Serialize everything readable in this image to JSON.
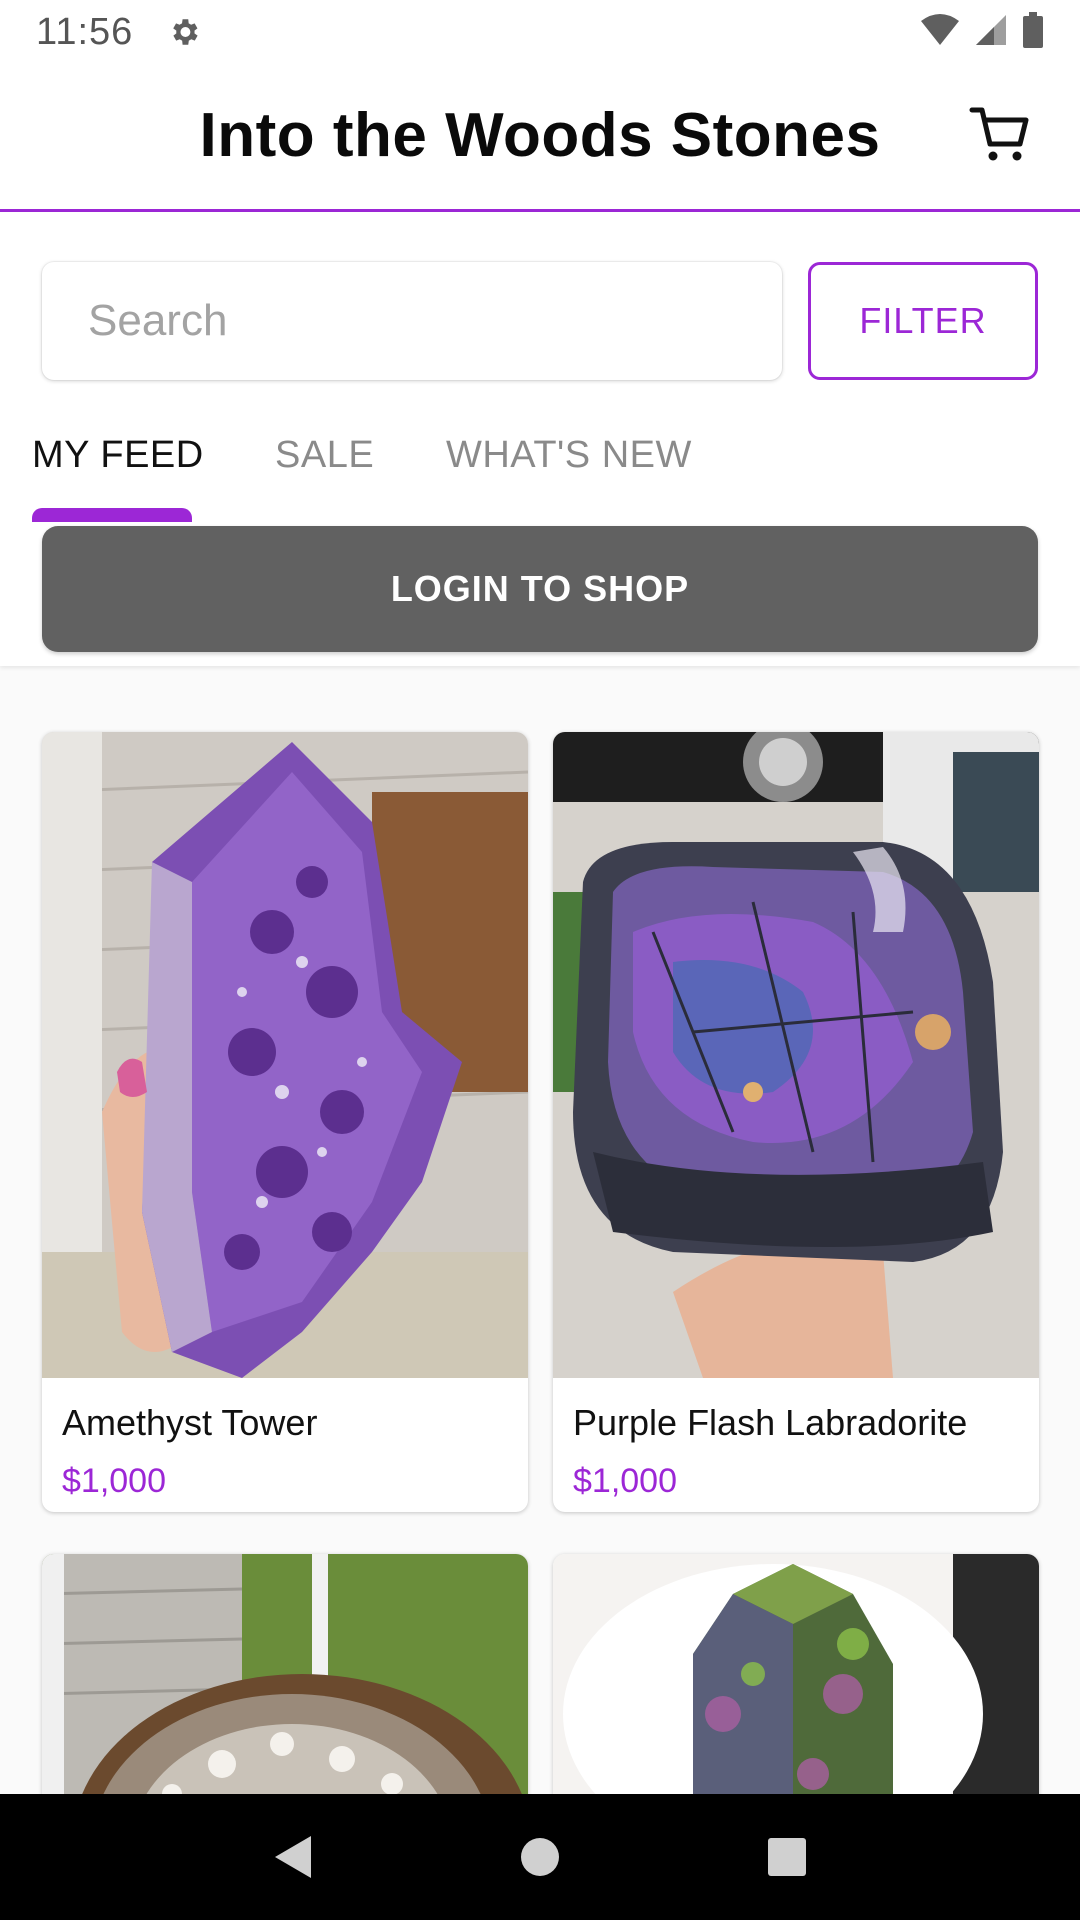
{
  "status_bar": {
    "time": "11:56",
    "icons": [
      "gear-icon",
      "wifi-icon",
      "signal-icon",
      "battery-icon"
    ]
  },
  "header": {
    "title": "Into the Woods Stones",
    "cart_icon": "cart-icon"
  },
  "search": {
    "placeholder": "Search",
    "value": ""
  },
  "filter": {
    "label": "FILTER"
  },
  "tabs": [
    {
      "label": "MY FEED",
      "active": true
    },
    {
      "label": "SALE",
      "active": false
    },
    {
      "label": "WHAT'S NEW",
      "active": false
    }
  ],
  "login": {
    "label": "LOGIN TO SHOP"
  },
  "products": [
    {
      "name": "Amethyst Tower",
      "price": "$1,000"
    },
    {
      "name": "Purple Flash Labradorite",
      "price": "$1,000"
    },
    {
      "name": "",
      "price": ""
    },
    {
      "name": "",
      "price": ""
    }
  ],
  "colors": {
    "accent": "#9c27d6",
    "login_button": "#616161",
    "nav_bar": "#000000"
  },
  "nav": [
    "back-icon",
    "home-icon",
    "recents-icon"
  ]
}
